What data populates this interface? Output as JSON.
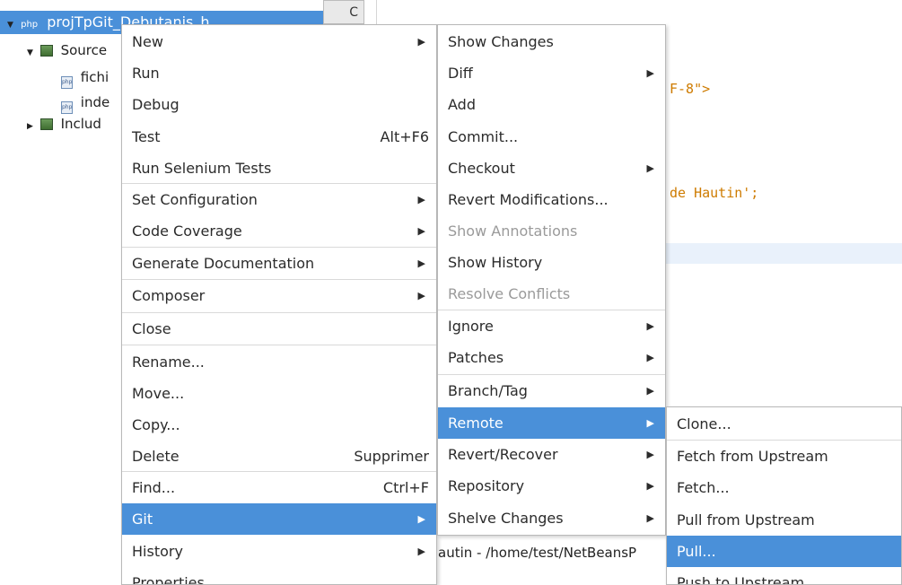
{
  "tree": {
    "root_label": "projTpGit_Debutanis_h",
    "root_icon": "php-project-icon",
    "items": [
      {
        "label": "Source",
        "icon": "source-package-icon"
      },
      {
        "label": "fichi",
        "icon": "php-file-icon"
      },
      {
        "label": "inde",
        "icon": "php-file-icon"
      },
      {
        "label": "Includ",
        "icon": "include-package-icon"
      }
    ]
  },
  "editor": {
    "splitter_label": "C",
    "line1": "F-8\">",
    "line2": "de Hautin';",
    "bottom_path": "autin - /home/test/NetBeansP"
  },
  "context_menu": {
    "items": [
      {
        "label": "New",
        "submenu": true
      },
      {
        "label": "Run"
      },
      {
        "label": "Debug"
      },
      {
        "label": "Test",
        "shortcut": "Alt+F6"
      },
      {
        "label": "Run Selenium Tests"
      },
      {
        "label": "Set Configuration",
        "submenu": true
      },
      {
        "label": "Code Coverage",
        "submenu": true
      },
      {
        "label": "Generate Documentation",
        "submenu": true
      },
      {
        "label": "Composer",
        "submenu": true
      },
      {
        "label": "Close"
      },
      {
        "label": "Rename..."
      },
      {
        "label": "Move..."
      },
      {
        "label": "Copy..."
      },
      {
        "label": "Delete",
        "shortcut": "Supprimer"
      },
      {
        "label": "Find...",
        "shortcut": "Ctrl+F"
      },
      {
        "label": "Git",
        "submenu": true,
        "selected": true
      },
      {
        "label": "History",
        "submenu": true
      },
      {
        "label": "Properties"
      }
    ]
  },
  "git_menu": {
    "items": [
      {
        "label": "Show Changes"
      },
      {
        "label": "Diff",
        "submenu": true
      },
      {
        "label": "Add"
      },
      {
        "label": "Commit..."
      },
      {
        "label": "Checkout",
        "submenu": true
      },
      {
        "label": "Revert Modifications..."
      },
      {
        "label": "Show Annotations",
        "disabled": true
      },
      {
        "label": "Show History"
      },
      {
        "label": "Resolve Conflicts",
        "disabled": true
      },
      {
        "label": "Ignore",
        "submenu": true
      },
      {
        "label": "Patches",
        "submenu": true
      },
      {
        "label": "Branch/Tag",
        "submenu": true
      },
      {
        "label": "Remote",
        "submenu": true,
        "selected": true
      },
      {
        "label": "Revert/Recover",
        "submenu": true
      },
      {
        "label": "Repository",
        "submenu": true
      },
      {
        "label": "Shelve Changes",
        "submenu": true
      }
    ]
  },
  "remote_menu": {
    "items": [
      {
        "label": "Clone..."
      },
      {
        "label": "Fetch from Upstream"
      },
      {
        "label": "Fetch..."
      },
      {
        "label": "Pull from Upstream"
      },
      {
        "label": "Pull...",
        "selected": true
      },
      {
        "label": "Push to Upstream"
      }
    ]
  },
  "colors": {
    "selection": "#4a90d9",
    "code_string": "#ce7b00",
    "disabled_text": "#9a9a9a"
  }
}
